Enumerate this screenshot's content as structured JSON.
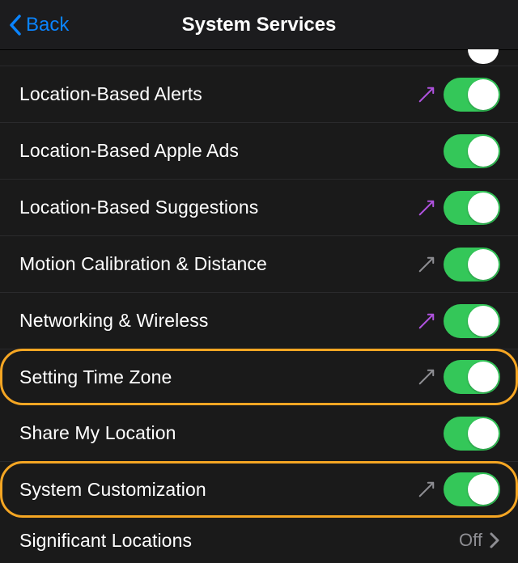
{
  "header": {
    "back_label": "Back",
    "title": "System Services"
  },
  "rows": [
    {
      "id": "location-based-alerts",
      "label": "Location-Based Alerts",
      "indicator": "purple",
      "toggle_on": true,
      "highlighted": false
    },
    {
      "id": "location-based-apple-ads",
      "label": "Location-Based Apple Ads",
      "indicator": "none",
      "toggle_on": true,
      "highlighted": false
    },
    {
      "id": "location-based-suggestions",
      "label": "Location-Based Suggestions",
      "indicator": "purple",
      "toggle_on": true,
      "highlighted": false
    },
    {
      "id": "motion-calibration-distance",
      "label": "Motion Calibration & Distance",
      "indicator": "gray",
      "toggle_on": true,
      "highlighted": false
    },
    {
      "id": "networking-wireless",
      "label": "Networking & Wireless",
      "indicator": "purple",
      "toggle_on": true,
      "highlighted": false
    },
    {
      "id": "setting-time-zone",
      "label": "Setting Time Zone",
      "indicator": "gray",
      "toggle_on": true,
      "highlighted": true
    },
    {
      "id": "share-my-location",
      "label": "Share My Location",
      "indicator": "none",
      "toggle_on": true,
      "highlighted": false
    },
    {
      "id": "system-customization",
      "label": "System Customization",
      "indicator": "gray",
      "toggle_on": true,
      "highlighted": true
    }
  ],
  "nav_row": {
    "id": "significant-locations",
    "label": "Significant Locations",
    "value": "Off"
  },
  "colors": {
    "toggle_on": "#34c759",
    "highlight": "#f5a623",
    "link": "#0a84ff",
    "indicator_purple": "#af52de",
    "indicator_gray": "#8e8e93"
  }
}
